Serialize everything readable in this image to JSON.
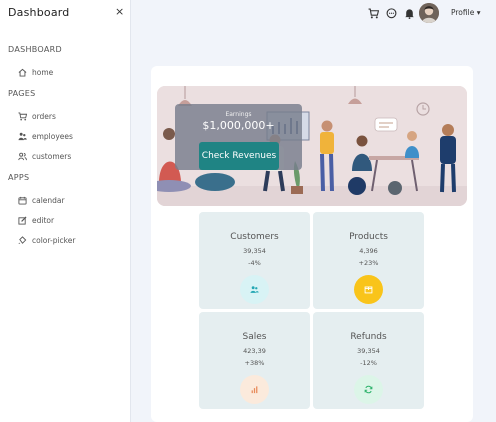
{
  "sidebar": {
    "title": "Dashboard",
    "close_icon": "×",
    "sections": [
      {
        "label": "DASHBOARD",
        "items": [
          {
            "label": "home",
            "icon": "home-icon"
          }
        ]
      },
      {
        "label": "PAGES",
        "items": [
          {
            "label": "orders",
            "icon": "cart-icon"
          },
          {
            "label": "employees",
            "icon": "people-icon"
          },
          {
            "label": "customers",
            "icon": "user-group-icon"
          }
        ]
      },
      {
        "label": "APPS",
        "items": [
          {
            "label": "calendar",
            "icon": "calendar-icon"
          },
          {
            "label": "editor",
            "icon": "edit-icon"
          },
          {
            "label": "color-picker",
            "icon": "color-bucket-icon"
          }
        ]
      }
    ]
  },
  "header": {
    "profile_label": "Profile ▾",
    "icons": [
      "cart-icon",
      "chat-icon",
      "bell-icon"
    ]
  },
  "banner": {
    "earnings_label": "Earnings",
    "earnings_value": "$1,000,000+",
    "button_label": "Check Revenues"
  },
  "stats": [
    {
      "title": "Customers",
      "value": "39,354",
      "change": "-4%",
      "icon": "customers-icon",
      "icon_bg": "#d8f3f5",
      "icon_color": "#24a7b3"
    },
    {
      "title": "Products",
      "value": "4,396",
      "change": "+23%",
      "icon": "box-icon",
      "icon_bg": "#f9c41a",
      "icon_color": "#ffffff"
    },
    {
      "title": "Sales",
      "value": "423,39",
      "change": "+38%",
      "icon": "bar-chart-icon",
      "icon_bg": "#fbeadc",
      "icon_color": "#e88a5a"
    },
    {
      "title": "Refunds",
      "value": "39,354",
      "change": "-12%",
      "icon": "refresh-icon",
      "icon_bg": "#dcf5e8",
      "icon_color": "#2fb36c"
    }
  ],
  "colors": {
    "accent": "#1f8484",
    "page_bg": "#f1f4fa",
    "stat_bg": "#e5eef0"
  }
}
